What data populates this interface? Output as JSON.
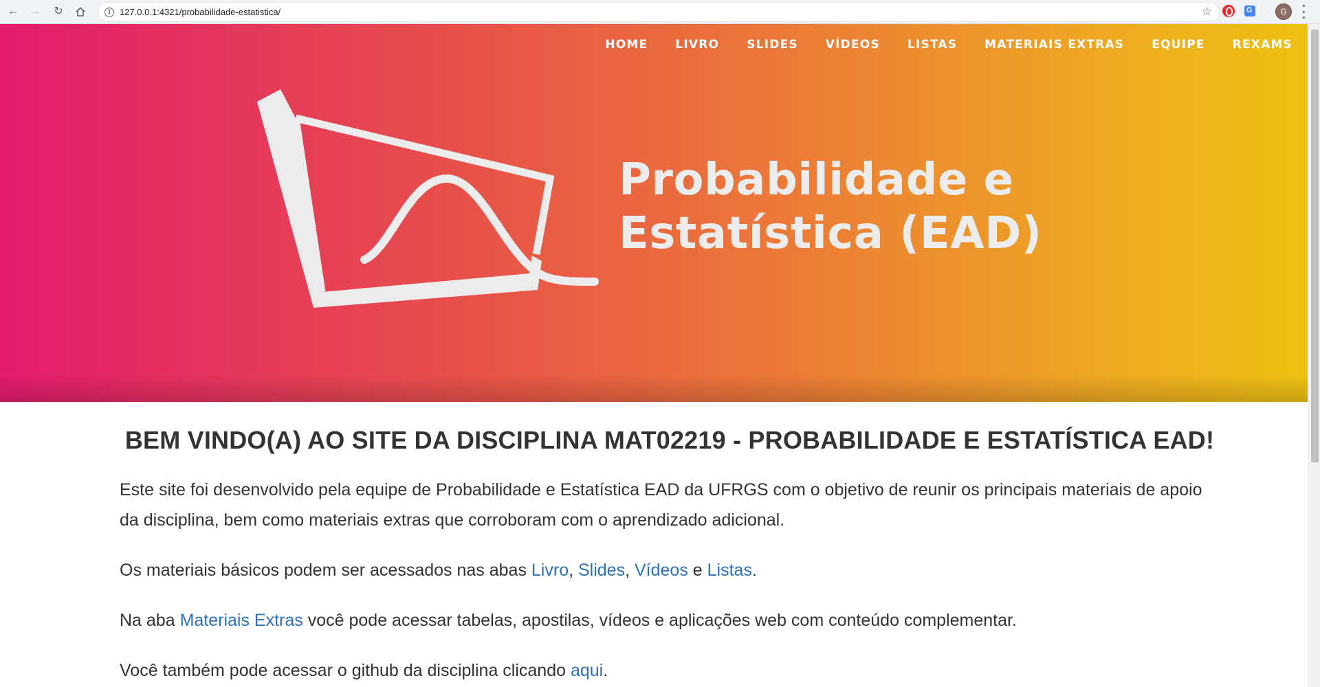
{
  "browser": {
    "url": "127.0.0.1:4321/probabilidade-estatistica/",
    "avatar_letter": "G",
    "translate_label": "G"
  },
  "nav": {
    "items": [
      "HOME",
      "LIVRO",
      "SLIDES",
      "VÍDEOS",
      "LISTAS",
      "MATERIAIS EXTRAS",
      "EQUIPE",
      "REXAMS"
    ]
  },
  "hero": {
    "logo_line1": "Probabilidade e",
    "logo_line2": "Estatística (EAD)",
    "gradient_colors": [
      "#e31b6d",
      "#e7504a",
      "#ec7d36",
      "#eeaa22",
      "#eec112"
    ]
  },
  "content": {
    "heading": "BEM VINDO(A) AO SITE DA DISCIPLINA MAT02219 - PROBABILIDADE E ESTATÍSTICA EAD!",
    "p1": "Este site foi desenvolvido pela equipe de Probabilidade e Estatística EAD da UFRGS com o objetivo de reunir os principais materiais de apoio da disciplina, bem como materiais extras que corroboram com o aprendizado adicional.",
    "p2_prefix": "Os materiais básicos podem ser acessados nas abas ",
    "p2_link1": "Livro",
    "p2_sep1": ", ",
    "p2_link2": "Slides",
    "p2_sep2": ", ",
    "p2_link3": "Vídeos",
    "p2_sep3": " e ",
    "p2_link4": "Listas",
    "p2_suffix": ".",
    "p3_prefix": "Na aba ",
    "p3_link": "Materiais Extras",
    "p3_suffix": " você pode acessar tabelas, apostilas, vídeos e aplicações web com conteúdo complementar.",
    "p4_prefix": "Você também pode acessar o github da disciplina clicando ",
    "p4_link": "aqui",
    "p4_suffix": ".",
    "link_color": "#2d72b8",
    "text_color": "#333333"
  }
}
